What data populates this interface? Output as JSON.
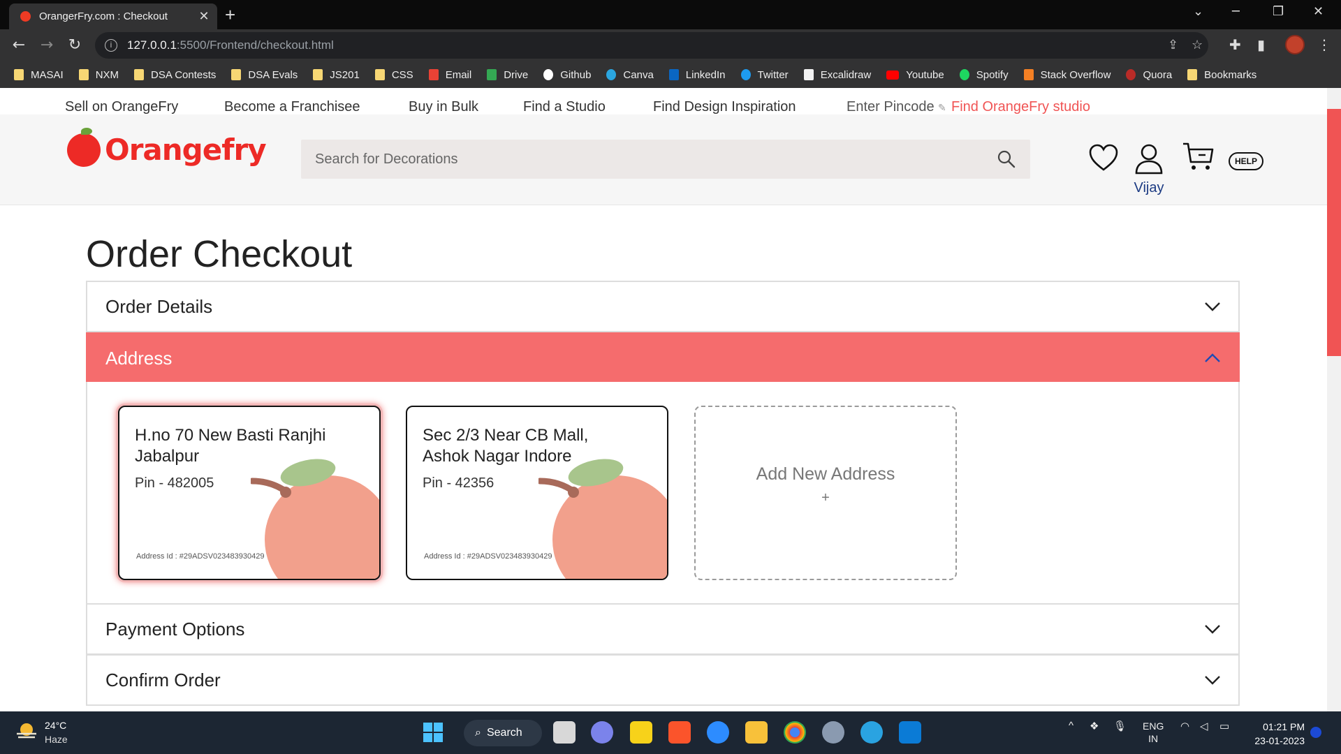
{
  "browser": {
    "tab_title": "OrangerFry.com : Checkout",
    "tab_close": "✕",
    "new_tab": "+",
    "url_host": "127.0.0.1",
    "url_path": ":5500/Frontend/checkout.html",
    "bookmarks": [
      "MASAI",
      "NXM",
      "DSA Contests",
      "DSA Evals",
      "JS201",
      "CSS",
      "Email",
      "Drive",
      "Github",
      "Canva",
      "LinkedIn",
      "Twitter",
      "Excalidraw",
      "Youtube",
      "Spotify",
      "Stack Overflow",
      "Quora",
      "Bookmarks"
    ]
  },
  "topstrip": {
    "sell": "Sell on OrangeFry",
    "franchise": "Become a Franchisee",
    "bulk": "Buy in Bulk",
    "studio": "Find a Studio",
    "inspiration": "Find Design Inspiration",
    "pincode": "Enter Pincode",
    "find_studio": "Find OrangeFry studio"
  },
  "header": {
    "brand": "Orangefry",
    "search_placeholder": "Search for Decorations",
    "user_name": "Vijay",
    "help": "HELP"
  },
  "main": {
    "title": "Order Checkout",
    "sections": {
      "order_details": "Order Details",
      "address": "Address",
      "payment": "Payment Options",
      "confirm": "Confirm Order"
    },
    "addresses": [
      {
        "line1": "H.no 70 New Basti Ranjhi Jabalpur",
        "pin": "Pin - 482005",
        "id": "Address Id : #29ADSV023483930429"
      },
      {
        "line1": "Sec 2/3 Near CB Mall, Ashok Nagar Indore",
        "pin": "Pin - 42356",
        "id": "Address Id : #29ADSV023483930429"
      }
    ],
    "add_new": {
      "label": "Add New Address",
      "plus": "+"
    }
  },
  "taskbar": {
    "temperature": "24°C",
    "weather": "Haze",
    "search": "Search",
    "lang1": "ENG",
    "lang2": "IN",
    "time": "01:21 PM",
    "date": "23-01-2023"
  }
}
